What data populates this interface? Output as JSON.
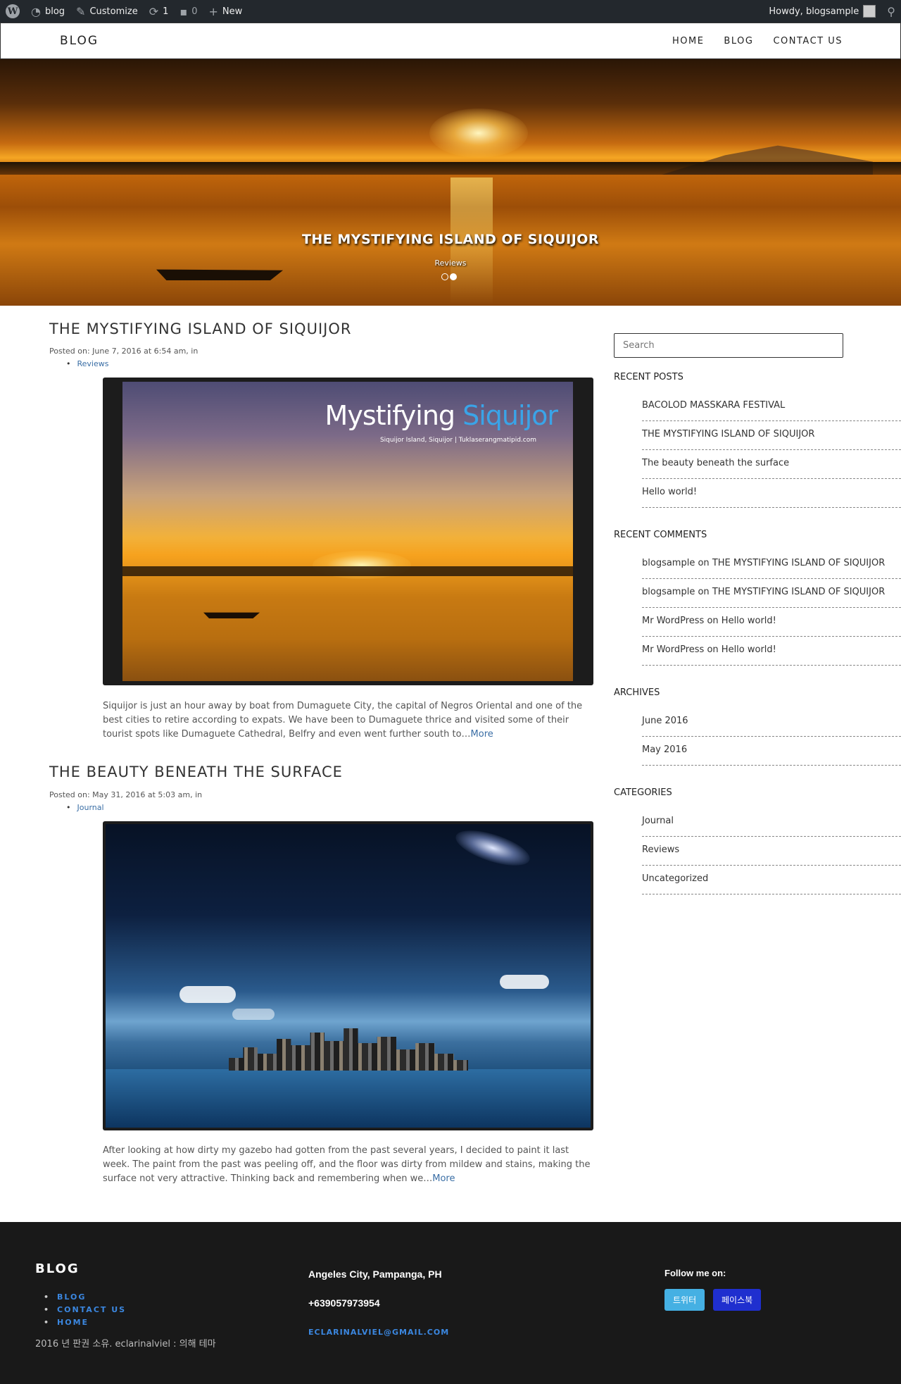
{
  "admin_bar": {
    "site_name": "blog",
    "customize": "Customize",
    "updates_count": "1",
    "comments_count": "0",
    "new_label": "New",
    "greeting": "Howdy, blogsample"
  },
  "header": {
    "logo": "BLOG",
    "nav": [
      "HOME",
      "BLOG",
      "CONTACT US"
    ]
  },
  "hero": {
    "title": "THE MYSTIFYING ISLAND OF SIQUIJOR",
    "category": "Reviews"
  },
  "posts": [
    {
      "title": "THE MYSTIFYING ISLAND OF SIQUIJOR",
      "meta": "Posted on: June 7, 2016 at 6:54 am, in",
      "category": "Reviews",
      "image_brand_1": "Mystifying ",
      "image_brand_2": "Siquijor",
      "image_sub": "Siquijor Island, Siquijor | Tuklaserangmatipid.com",
      "excerpt": "Siquijor is just an hour away by boat from Dumaguete City, the capital of Negros Oriental and one of the best cities to retire according to expats. We have been to Dumaguete thrice and visited some of their tourist spots like Dumaguete Cathedral, Belfry and even went further south to…",
      "more": "More"
    },
    {
      "title": "THE BEAUTY BENEATH THE SURFACE",
      "meta": "Posted on: May 31, 2016 at 5:03 am, in",
      "category": "Journal",
      "excerpt": "After looking at how dirty my gazebo had gotten from the past several years, I decided to paint it last week. The paint from the past was peeling off, and the floor was dirty from mildew and stains, making the surface not very attractive. Thinking back and remembering when we…",
      "more": "More"
    }
  ],
  "sidebar": {
    "search_placeholder": "Search",
    "recent_posts_title": "RECENT POSTS",
    "recent_posts": [
      "BACOLOD MASSKARA FESTIVAL",
      "THE MYSTIFYING ISLAND OF SIQUIJOR",
      "The beauty beneath the surface",
      "Hello world!"
    ],
    "recent_comments_title": "RECENT COMMENTS",
    "recent_comments": [
      {
        "author": "blogsample",
        "on": " on ",
        "post": "THE MYSTIFYING ISLAND OF SIQUIJOR"
      },
      {
        "author": "blogsample",
        "on": " on ",
        "post": "THE MYSTIFYING ISLAND OF SIQUIJOR"
      },
      {
        "author": "Mr WordPress",
        "on": " on ",
        "post": "Hello world!"
      },
      {
        "author": "Mr WordPress",
        "on": " on ",
        "post": "Hello world!"
      }
    ],
    "archives_title": "ARCHIVES",
    "archives": [
      "June 2016",
      "May 2016"
    ],
    "categories_title": "CATEGORIES",
    "categories": [
      "Journal",
      "Reviews",
      "Uncategorized"
    ]
  },
  "footer": {
    "logo": "BLOG",
    "links": [
      "BLOG",
      "CONTACT US",
      "HOME"
    ],
    "copyright": "2016 년 판권 소유. eclarinalviel : 의해 테마",
    "address": "Angeles City, Pampanga, PH",
    "phone": "+639057973954",
    "email": "ECLARINALVIEL@GMAIL.COM",
    "follow": "Follow me on:",
    "twitter": "트위터",
    "facebook": "페이스북"
  }
}
